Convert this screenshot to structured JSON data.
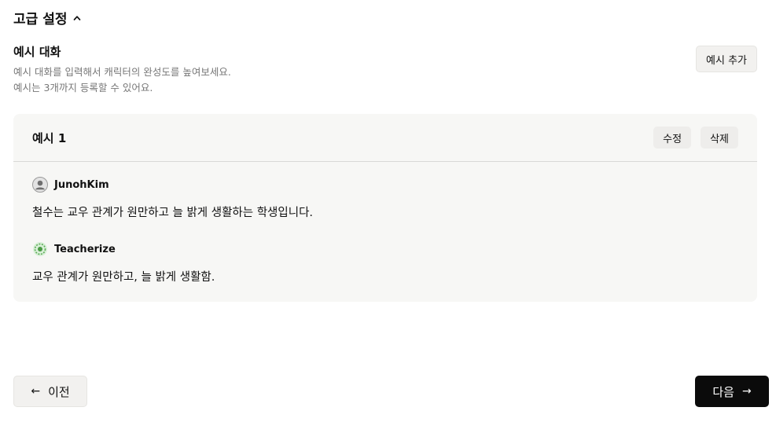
{
  "advanced": {
    "title": "고급 설정",
    "chevron_icon": "chevron-up-icon"
  },
  "examples": {
    "heading": "예시 대화",
    "desc_line1": "예시 대화를 입력해서 캐릭터의 완성도를 높여보세요.",
    "desc_line2": "예시는 3개까지 등록할 수 있어요.",
    "add_label": "예시 추가"
  },
  "card": {
    "title": "예시 1",
    "edit_label": "수정",
    "delete_label": "삭제",
    "messages": [
      {
        "name": "JunohKim",
        "avatar_icon": "user-avatar-icon",
        "text": "철수는 교우 관계가 원만하고 늘 밝게 생활하는 학생입니다."
      },
      {
        "name": "Teacherize",
        "avatar_icon": "teacherize-logo-icon",
        "text": "교우 관계가 원만하고, 늘 밝게 생활함."
      }
    ]
  },
  "nav": {
    "prev_label": "이전",
    "prev_icon": "arrow-left-icon",
    "next_label": "다음",
    "next_icon": "arrow-right-icon"
  },
  "colors": {
    "primary_button": "#0b0b0b",
    "card_bg": "#f7f7f5",
    "muted_text": "#777777"
  }
}
